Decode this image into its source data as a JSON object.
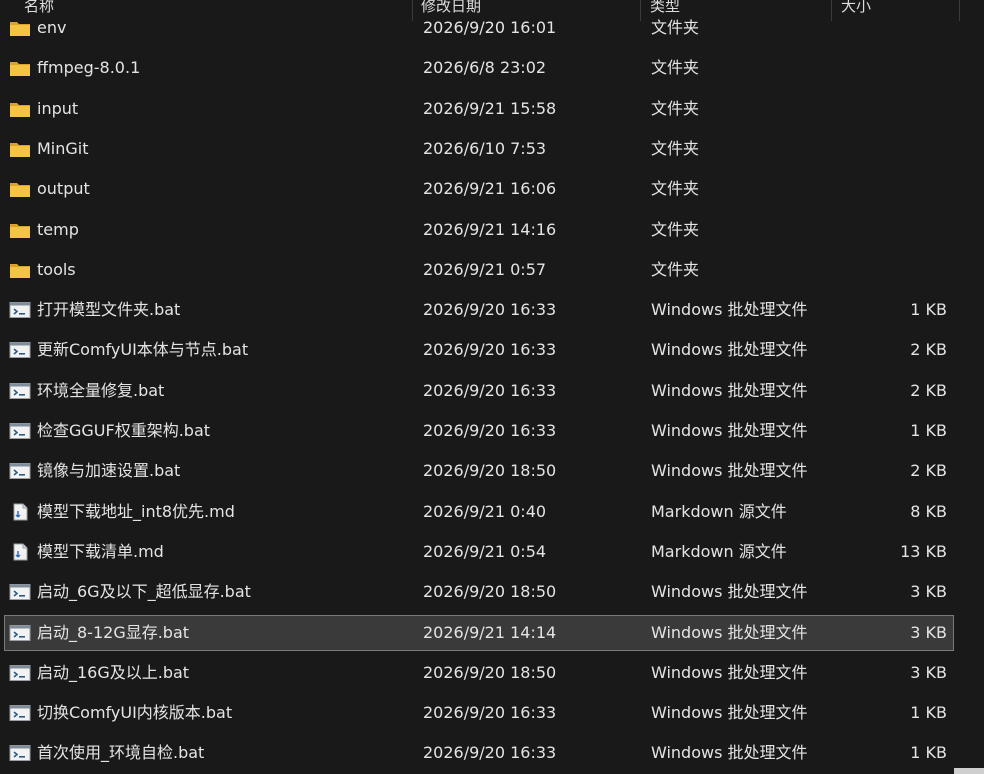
{
  "columns": {
    "name": "名称",
    "date": "修改日期",
    "type": "类型",
    "size": "大小"
  },
  "files": [
    {
      "name": "env",
      "date": "2026/9/20 16:01",
      "type": "文件夹",
      "size": "",
      "icon": "folder-icon"
    },
    {
      "name": "ffmpeg-8.0.1",
      "date": "2026/6/8 23:02",
      "type": "文件夹",
      "size": "",
      "icon": "folder-icon"
    },
    {
      "name": "input",
      "date": "2026/9/21 15:58",
      "type": "文件夹",
      "size": "",
      "icon": "folder-icon"
    },
    {
      "name": "MinGit",
      "date": "2026/6/10 7:53",
      "type": "文件夹",
      "size": "",
      "icon": "folder-icon"
    },
    {
      "name": "output",
      "date": "2026/9/21 16:06",
      "type": "文件夹",
      "size": "",
      "icon": "folder-icon"
    },
    {
      "name": "temp",
      "date": "2026/9/21 14:16",
      "type": "文件夹",
      "size": "",
      "icon": "folder-icon"
    },
    {
      "name": "tools",
      "date": "2026/9/21 0:57",
      "type": "文件夹",
      "size": "",
      "icon": "folder-icon"
    },
    {
      "name": "打开模型文件夹.bat",
      "date": "2026/9/20 16:33",
      "type": "Windows 批处理文件",
      "size": "1 KB",
      "icon": "batch-file-icon"
    },
    {
      "name": "更新ComfyUI本体与节点.bat",
      "date": "2026/9/20 16:33",
      "type": "Windows 批处理文件",
      "size": "2 KB",
      "icon": "batch-file-icon"
    },
    {
      "name": "环境全量修复.bat",
      "date": "2026/9/20 16:33",
      "type": "Windows 批处理文件",
      "size": "2 KB",
      "icon": "batch-file-icon"
    },
    {
      "name": "检查GGUF权重架构.bat",
      "date": "2026/9/20 16:33",
      "type": "Windows 批处理文件",
      "size": "1 KB",
      "icon": "batch-file-icon"
    },
    {
      "name": "镜像与加速设置.bat",
      "date": "2026/9/20 18:50",
      "type": "Windows 批处理文件",
      "size": "2 KB",
      "icon": "batch-file-icon"
    },
    {
      "name": "模型下载地址_int8优先.md",
      "date": "2026/9/21 0:40",
      "type": "Markdown 源文件",
      "size": "8 KB",
      "icon": "markdown-file-icon"
    },
    {
      "name": "模型下载清单.md",
      "date": "2026/9/21 0:54",
      "type": "Markdown 源文件",
      "size": "13 KB",
      "icon": "markdown-file-icon"
    },
    {
      "name": "启动_6G及以下_超低显存.bat",
      "date": "2026/9/20 18:50",
      "type": "Windows 批处理文件",
      "size": "3 KB",
      "icon": "batch-file-icon"
    },
    {
      "name": "启动_8-12G显存.bat",
      "date": "2026/9/21 14:14",
      "type": "Windows 批处理文件",
      "size": "3 KB",
      "icon": "batch-file-icon",
      "selected": true
    },
    {
      "name": "启动_16G及以上.bat",
      "date": "2026/9/20 18:50",
      "type": "Windows 批处理文件",
      "size": "3 KB",
      "icon": "batch-file-icon"
    },
    {
      "name": "切换ComfyUI内核版本.bat",
      "date": "2026/9/20 16:33",
      "type": "Windows 批处理文件",
      "size": "1 KB",
      "icon": "batch-file-icon"
    },
    {
      "name": "首次使用_环境自检.bat",
      "date": "2026/9/20 16:33",
      "type": "Windows 批处理文件",
      "size": "1 KB",
      "icon": "batch-file-icon"
    }
  ],
  "colors": {
    "background": "#191919",
    "selection": "#3a3a3a",
    "folder": "#f4c542"
  }
}
